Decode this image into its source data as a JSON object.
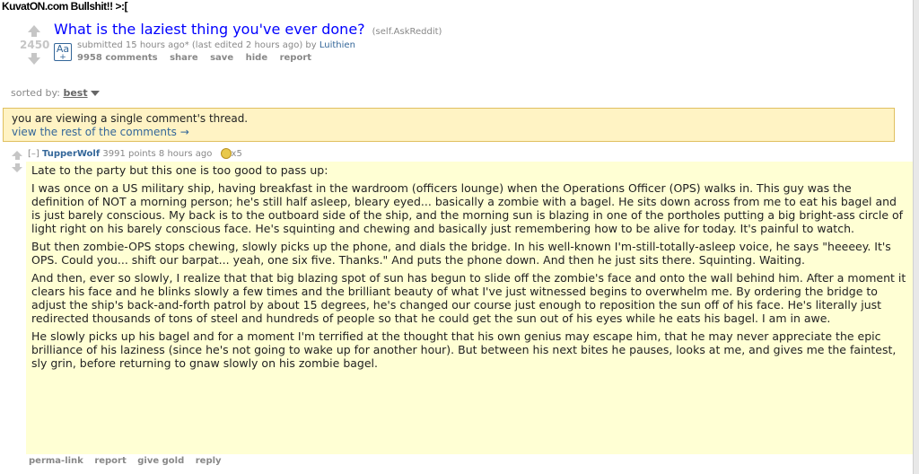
{
  "watermark": "KuvatON.com Bullshit!! >:[",
  "post": {
    "score": "2450",
    "thumbnail_label": "Aa",
    "thumbnail_plus": "+",
    "title": "What is the laziest thing you've ever done?",
    "domain": "(self.AskReddit)",
    "tagline_prefix": "submitted 15 hours ago* (last edited 2 hours ago) by",
    "author": "Luithien",
    "buttons": [
      "9958 comments",
      "share",
      "save",
      "hide",
      "report"
    ]
  },
  "sort": {
    "label": "sorted by:",
    "value": "best"
  },
  "notice": {
    "text": "you are viewing a single comment's thread.",
    "link": "view the rest of the comments →"
  },
  "comment": {
    "collapse": "[–]",
    "author": "TupperWolf",
    "meta": "3991 points 8 hours ago",
    "gilded": "x5",
    "paragraphs": [
      "Late to the party but this one is too good to pass up:",
      "I was once on a US military ship, having breakfast in the wardroom (officers lounge) when the Operations Officer (OPS) walks in. This guy was the definition of NOT a morning person; he's still half asleep, bleary eyed... basically a zombie with a bagel. He sits down across from me to eat his bagel and is just barely conscious. My back is to the outboard side of the ship, and the morning sun is blazing in one of the portholes putting a big bright-ass circle of light right on his barely conscious face. He's squinting and chewing and basically just remembering how to be alive for today. It's painful to watch.",
      "But then zombie-OPS stops chewing, slowly picks up the phone, and dials the bridge. In his well-known I'm-still-totally-asleep voice, he says \"heeeey. It's OPS. Could you... shift our barpat... yeah, one six five. Thanks.\" And puts the phone down. And then he just sits there. Squinting. Waiting.",
      "And then, ever so slowly, I realize that that big blazing spot of sun has begun to slide off the zombie's face and onto the wall behind him. After a moment it clears his face and he blinks slowly a few times and the brilliant beauty of what I've just witnessed begins to overwhelm me. By ordering the bridge to adjust the ship's back-and-forth patrol by about 15 degrees, he's changed our course just enough to reposition the sun off of his face. He's literally just redirected thousands of tons of steel and hundreds of people so that he could get the sun out of his eyes while he eats his bagel. I am in awe.",
      "He slowly picks up his bagel and for a moment I'm terrified at the thought that his own genius may escape him, that he may never appreciate the epic brilliance of his laziness (since he's not going to wake up for another hour). But between his next bites he pauses, looks at me, and gives me the faintest, sly grin, before returning to gnaw slowly on his zombie bagel."
    ],
    "links": [
      "perma-link",
      "report",
      "give gold",
      "reply"
    ]
  }
}
